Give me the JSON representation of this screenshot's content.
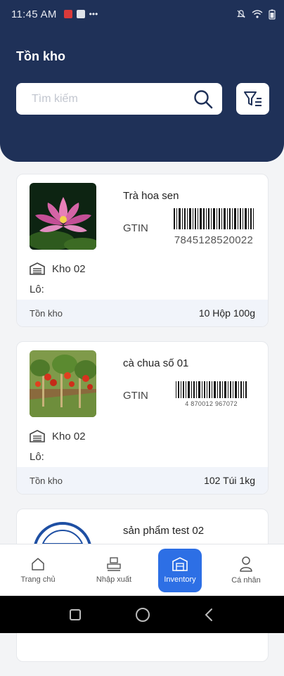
{
  "status_bar": {
    "time": "11:45 AM",
    "more": "•••"
  },
  "header": {
    "title": "Tồn kho",
    "search_placeholder": "Tìm kiếm"
  },
  "products": [
    {
      "name": "Trà hoa sen",
      "gtin_label": "GTIN",
      "barcode": "7845128520022",
      "warehouse": "Kho 02",
      "lot_label": "Lô:",
      "stock_label": "Tồn kho",
      "stock_value": "10 Hộp 100g"
    },
    {
      "name": "cà chua số 01",
      "gtin_label": "GTIN",
      "barcode": "4 870012 967072",
      "warehouse": "Kho 02",
      "lot_label": "Lô:",
      "stock_label": "Tồn kho",
      "stock_value": "102 Túi 1kg"
    },
    {
      "name": "sản phẩm test 02"
    }
  ],
  "nav": {
    "home": "Trang chủ",
    "import_export": "Nhập xuất",
    "inventory": "Inventory",
    "personal": "Cá nhân"
  },
  "colors": {
    "header": "#1f3158",
    "accent": "#2d6fe5"
  }
}
